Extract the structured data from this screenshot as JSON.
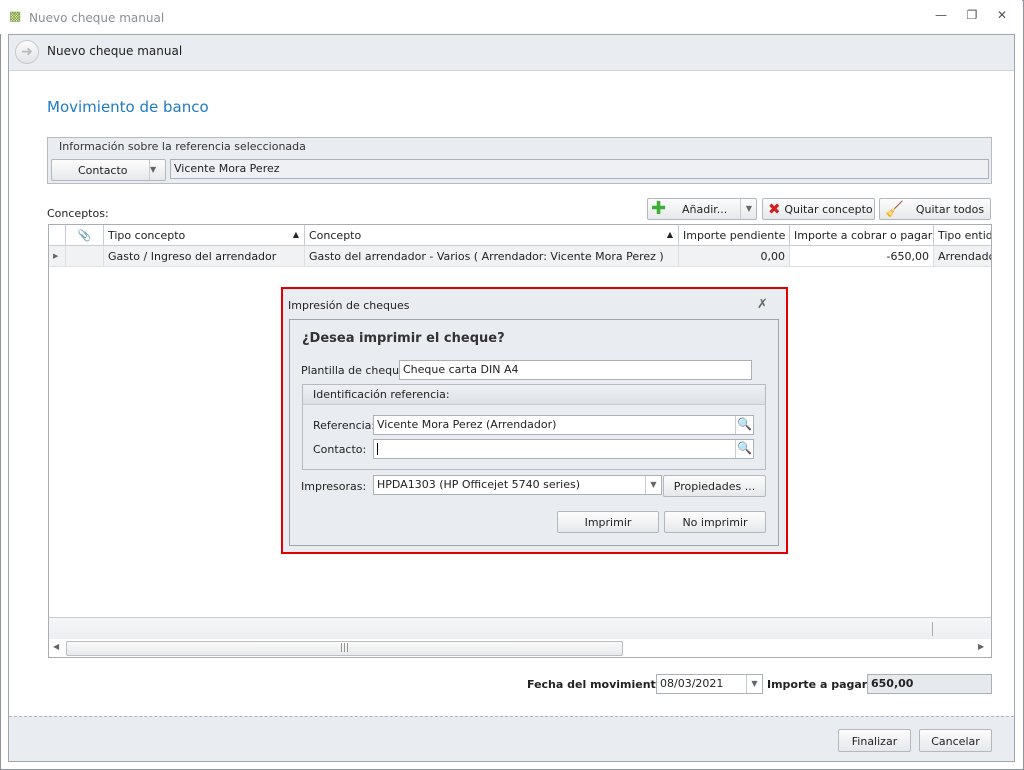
{
  "window": {
    "title": "Nuevo cheque manual",
    "header": "Nuevo cheque manual"
  },
  "section_title": "Movimiento de banco",
  "info": {
    "title": "Información sobre la referencia seleccionada",
    "type_value": "Contacto",
    "name_value": "Vicente Mora Perez"
  },
  "concepts": {
    "label": "Conceptos:",
    "add": "Añadir...",
    "remove": "Quitar concepto",
    "remove_all": "Quitar todos"
  },
  "grid": {
    "columns": [
      "Tipo concepto",
      "Concepto",
      "Importe pendiente",
      "Importe a cobrar o pagar",
      "Tipo entidad"
    ],
    "rows": [
      [
        "Gasto / Ingreso del arrendador",
        "Gasto del arrendador - Varios ( Arrendador: Vicente Mora Perez )",
        "0,00",
        "-650,00",
        "Arrendador"
      ]
    ]
  },
  "dialog": {
    "title": "Impresión de cheques",
    "question": "¿Desea imprimir el cheque?",
    "template_label": "Plantilla de cheque:",
    "template_value": "Cheque carta DIN A4",
    "id_group": "Identificación referencia:",
    "ref_label": "Referencia:",
    "ref_value": "Vicente Mora Perez (Arrendador)",
    "contact_label": "Contacto:",
    "contact_value": "",
    "printer_label": "Impresoras:",
    "printer_value": "HPDA1303 (HP Officejet 5740 series)",
    "properties": "Propiedades ...",
    "print": "Imprimir",
    "no_print": "No imprimir"
  },
  "footer": {
    "date_label": "Fecha del movimiento",
    "date_value": "08/03/2021",
    "amount_label": "Importe a pagar:",
    "amount_value": "650,00"
  },
  "actions": {
    "finish": "Finalizar",
    "cancel": "Cancelar"
  }
}
